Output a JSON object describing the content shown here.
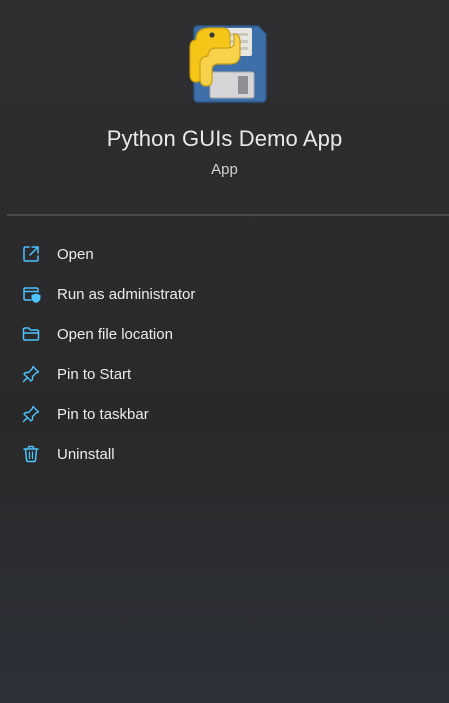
{
  "app": {
    "title": "Python GUIs Demo App",
    "type": "App",
    "icon": "python-floppy-disk-icon"
  },
  "menu": {
    "items": [
      {
        "label": "Open",
        "icon": "open-external-icon"
      },
      {
        "label": "Run as administrator",
        "icon": "shield-window-icon"
      },
      {
        "label": "Open file location",
        "icon": "folder-icon"
      },
      {
        "label": "Pin to Start",
        "icon": "pin-icon"
      },
      {
        "label": "Pin to taskbar",
        "icon": "pin-icon"
      },
      {
        "label": "Uninstall",
        "icon": "trash-icon"
      }
    ]
  },
  "colors": {
    "accent": "#4cc2ff",
    "background": "#2b2b2d",
    "text": "#ececee"
  }
}
